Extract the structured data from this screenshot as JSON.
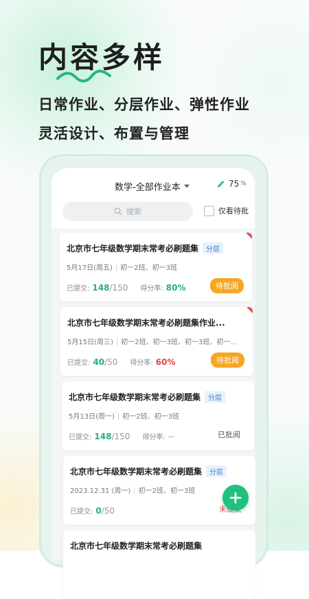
{
  "promo": {
    "headline": "内容多样",
    "line1": "日常作业、分层作业、弹性作业",
    "line2": "灵活设计、布置与管理"
  },
  "app": {
    "title": "数学-全部作业本",
    "battery_value": "75",
    "battery_unit": "%",
    "search_placeholder": "搜索",
    "filter_label": "仅看待批",
    "submitted_label": "已提交:",
    "score_label": "得分率:"
  },
  "assignments": [
    {
      "title": "北京市七年级数学期末常考必刷题集",
      "tag": "分层",
      "date": "5月17日(周五)",
      "classes": "初一2班、初一3班",
      "submitted": "148",
      "total": "/150",
      "score": "80%",
      "score_color": "#26b07a",
      "status": "待批阅",
      "flag": true
    },
    {
      "title": "北京市七年级数学期末常考必刷题集作业...",
      "tag": "",
      "date": "5月15日(周三)",
      "classes": "初一2班、初一3班、初一3班、初一...",
      "submitted": "40",
      "total": "/50",
      "score": "60%",
      "score_color": "#e04545",
      "status": "待批阅",
      "flag": true
    },
    {
      "title": "北京市七年级数学期末常考必刷题集",
      "tag": "分层",
      "date": "5月13日(周一)",
      "classes": "初一2班、初一3班",
      "submitted": "148",
      "total": "/150",
      "score": "--",
      "score_color": "#999999",
      "status": "已批阅",
      "flag": false
    },
    {
      "title": "北京市七年级数学期末常考必刷题集",
      "tag": "分层",
      "date": "2023.12.31 (周一)",
      "classes": "初一2班、初一3班",
      "submitted": "0",
      "total": "/50",
      "score": "",
      "score_color": "#999999",
      "status": "未提交",
      "flag": false
    },
    {
      "title": "北京市七年级数学期末常考必刷题集",
      "tag": "",
      "date": "",
      "classes": "",
      "submitted": "",
      "total": "",
      "score": "",
      "score_color": "#999999",
      "status": "",
      "flag": false
    }
  ],
  "colors": {
    "accent": "#22c07f",
    "pending": "#f6a623",
    "flag": "#e84b4b"
  },
  "icons": {
    "battery": "pencil-icon",
    "search": "search-icon",
    "fab": "plus-icon"
  }
}
